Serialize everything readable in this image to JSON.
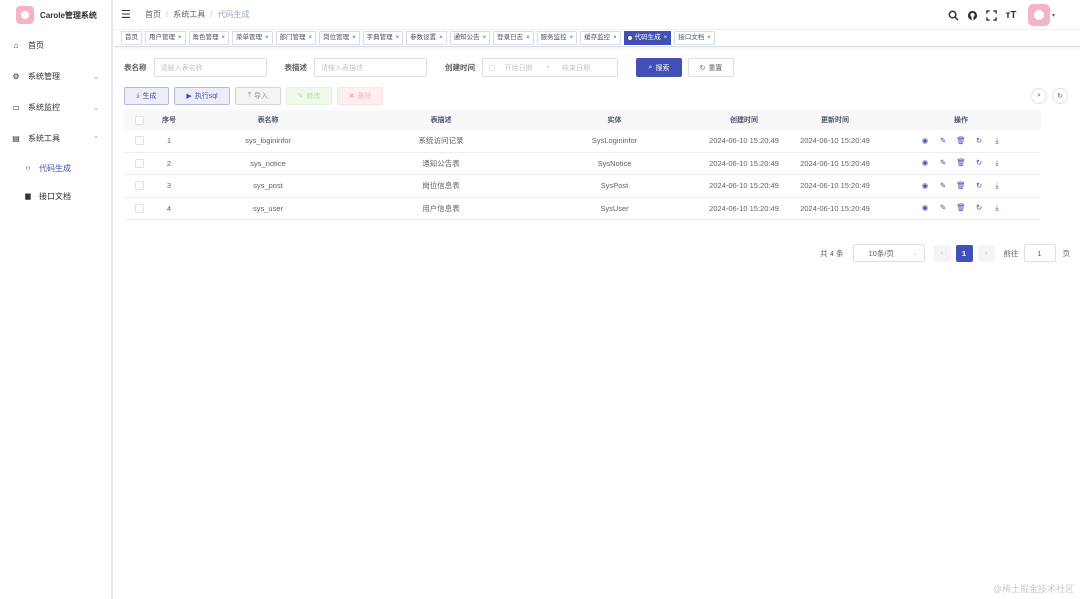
{
  "app": {
    "title": "Carole管理系统"
  },
  "sidebar": {
    "items": [
      {
        "label": "首页",
        "icon": "dashboard-icon",
        "glyph": "⌂"
      },
      {
        "label": "系统管理",
        "icon": "gear-icon",
        "glyph": "⚙",
        "arrow": "⌄"
      },
      {
        "label": "系统监控",
        "icon": "monitor-icon",
        "glyph": "▭",
        "arrow": "⌄"
      },
      {
        "label": "系统工具",
        "icon": "toolbox-icon",
        "glyph": "▤",
        "arrow": "⌃"
      }
    ],
    "sub_items": [
      {
        "label": "代码生成",
        "icon": "code-icon",
        "glyph": "‹›",
        "active": true
      },
      {
        "label": "接口文档",
        "icon": "document-icon",
        "glyph": "▆",
        "active": false
      }
    ]
  },
  "navbar": {
    "breadcrumb": [
      "首页",
      "系统工具",
      "代码生成"
    ],
    "separator": "/"
  },
  "tags": [
    {
      "label": "首页",
      "closable": false
    },
    {
      "label": "用户管理",
      "closable": true
    },
    {
      "label": "角色管理",
      "closable": true
    },
    {
      "label": "菜单管理",
      "closable": true
    },
    {
      "label": "部门管理",
      "closable": true
    },
    {
      "label": "岗位管理",
      "closable": true
    },
    {
      "label": "字典管理",
      "closable": true
    },
    {
      "label": "参数设置",
      "closable": true
    },
    {
      "label": "通知公告",
      "closable": true
    },
    {
      "label": "登录日志",
      "closable": true
    },
    {
      "label": "服务监控",
      "closable": true
    },
    {
      "label": "缓存监控",
      "closable": true
    },
    {
      "label": "代码生成",
      "closable": true,
      "active": true
    },
    {
      "label": "接口文档",
      "closable": true
    }
  ],
  "search": {
    "table_name_label": "表名称",
    "table_name_placeholder": "请输入表名称",
    "table_desc_label": "表描述",
    "table_desc_placeholder": "请输入表描述",
    "created_label": "创建时间",
    "start_placeholder": "开始日期",
    "range_sep": "-",
    "end_placeholder": "结束日期",
    "search_btn": "搜索",
    "reset_btn": "重置"
  },
  "toolbar": {
    "generate": "生成",
    "exec_sql": "执行sql",
    "import": "导入",
    "modify": "修改",
    "delete": "删除"
  },
  "table": {
    "headers": [
      "序号",
      "表名称",
      "表描述",
      "实体",
      "创建时间",
      "更新时间",
      "操作"
    ],
    "rows": [
      {
        "idx": "1",
        "name": "sys_logininfor",
        "desc": "系统访问记录",
        "entity": "SysLogininfor",
        "created": "2024-06-10 15:20:49",
        "updated": "2024-06-10 15:20:49"
      },
      {
        "idx": "2",
        "name": "sys_notice",
        "desc": "通知公告表",
        "entity": "SysNotice",
        "created": "2024-06-10 15:20:49",
        "updated": "2024-06-10 15:20:49"
      },
      {
        "idx": "3",
        "name": "sys_post",
        "desc": "岗位信息表",
        "entity": "SysPost",
        "created": "2024-06-10 15:20:49",
        "updated": "2024-06-10 15:20:49"
      },
      {
        "idx": "4",
        "name": "sys_user",
        "desc": "用户信息表",
        "entity": "SysUser",
        "created": "2024-06-10 15:20:49",
        "updated": "2024-06-10 15:20:49"
      }
    ],
    "row_actions": [
      {
        "icon": "preview-icon",
        "glyph": "◉"
      },
      {
        "icon": "edit-icon",
        "glyph": "✎"
      },
      {
        "icon": "delete-icon",
        "glyph": "🗑"
      },
      {
        "icon": "sync-icon",
        "glyph": "↻"
      },
      {
        "icon": "download-icon",
        "glyph": "⤓"
      }
    ]
  },
  "pagination": {
    "total_text": "共 4 条",
    "page_size": "10条/页",
    "current_page": "1",
    "goto_label": "前往",
    "goto_value": "1",
    "page_suffix": "页"
  },
  "watermark": "@稀土掘金技术社区",
  "colors": {
    "primary": "#4050b5",
    "sidebar_text": "#303133",
    "border": "#dcdfe6"
  }
}
